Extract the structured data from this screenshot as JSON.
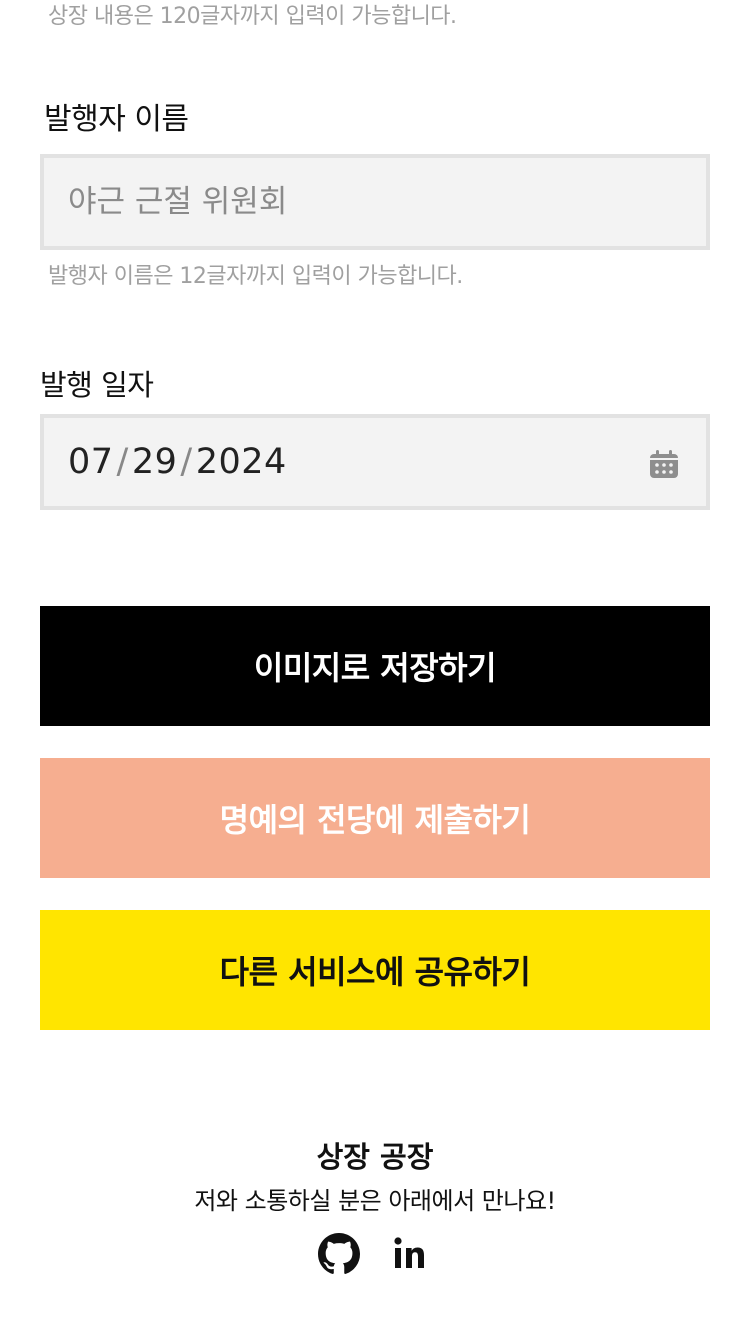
{
  "form": {
    "content_hint": "상장 내용은 120글자까지 입력이 가능합니다.",
    "issuer_label": "발행자 이름",
    "issuer_placeholder": "야근 근절 위원회",
    "issuer_hint": "발행자 이름은 12글자까지 입력이 가능합니다.",
    "date_label": "발행 일자",
    "date": {
      "month": "07",
      "day": "29",
      "year": "2024",
      "separator": "/"
    }
  },
  "actions": {
    "save_image_label": "이미지로 저장하기",
    "submit_hall_label": "명예의 전당에 제출하기",
    "share_label": "다른 서비스에 공유하기"
  },
  "footer": {
    "title": "상장 공장",
    "subtitle": "저와 소통하실 분은 아래에서 만나요!",
    "icons": [
      "github-icon",
      "linkedin-icon"
    ]
  },
  "colors": {
    "save_bg": "#000000",
    "save_fg": "#ffffff",
    "submit_bg": "#f6ae90",
    "submit_fg": "#ffffff",
    "share_bg": "#ffe500",
    "share_fg": "#111111"
  }
}
